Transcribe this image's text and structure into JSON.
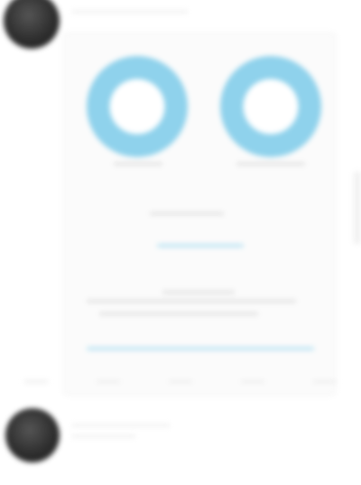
{
  "post_top": {
    "author": "",
    "stats": [
      {
        "value": "",
        "label": ""
      },
      {
        "value": "",
        "label": ""
      }
    ],
    "caption": "",
    "link_label": "",
    "link_url": ""
  },
  "post_bottom": {
    "author": "",
    "footer_actions": [
      "",
      "",
      "",
      ""
    ]
  },
  "colors": {
    "accent": "#8fd2ec",
    "link": "#6cc4e6",
    "avatar": "#2e2e2e",
    "background": "#ffffff"
  }
}
